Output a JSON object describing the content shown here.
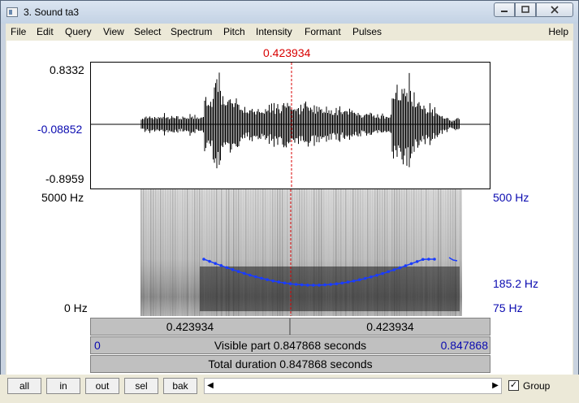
{
  "window": {
    "title": "3. Sound ta3"
  },
  "menu": {
    "items": [
      "File",
      "Edit",
      "Query",
      "View",
      "Select",
      "Spectrum",
      "Pitch",
      "Intensity",
      "Formant",
      "Pulses"
    ],
    "help": "Help"
  },
  "cursor": {
    "time": "0.423934"
  },
  "waveform": {
    "max_label": "0.8332",
    "zero_label": "-0.08852",
    "min_label": "-0.8959"
  },
  "spectrogram": {
    "freq_top": "5000 Hz",
    "freq_bottom": "0 Hz",
    "pitch_top": "500 Hz",
    "pitch_mid": "185.2 Hz",
    "pitch_bottom": "75 Hz"
  },
  "timebars": {
    "left_segment": "0.423934",
    "right_segment": "0.423934",
    "visible_start": "0",
    "visible_text": "Visible part 0.847868 seconds",
    "visible_end": "0.847868",
    "total_text": "Total duration 0.847868 seconds"
  },
  "controls": {
    "buttons": [
      "all",
      "in",
      "out",
      "sel",
      "bak"
    ],
    "group_label": "Group",
    "group_checked": true
  },
  "colors": {
    "cursor": "#d80000",
    "pitch": "#1a3cff",
    "axis_blue": "#0a0ab0"
  }
}
